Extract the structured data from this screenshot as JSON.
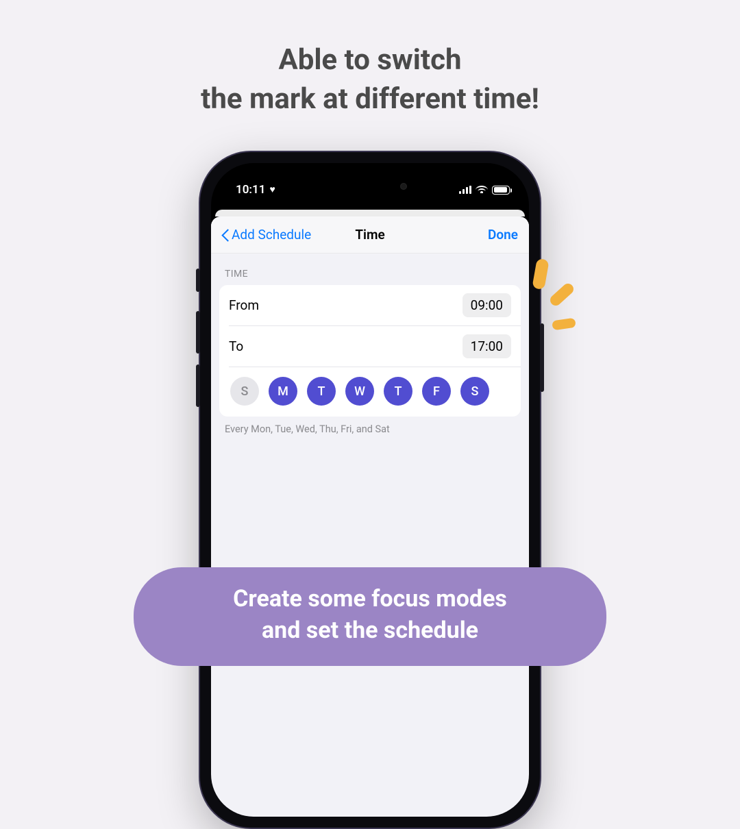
{
  "headline": {
    "line1": "Able to switch",
    "line2": "the mark at different time!"
  },
  "statusbar": {
    "time": "10:11"
  },
  "navbar": {
    "back_label": "Add Schedule",
    "title": "Time",
    "done_label": "Done"
  },
  "section": {
    "header": "TIME",
    "from_label": "From",
    "from_value": "09:00",
    "to_label": "To",
    "to_value": "17:00"
  },
  "days": [
    {
      "letter": "S",
      "selected": false
    },
    {
      "letter": "M",
      "selected": true
    },
    {
      "letter": "T",
      "selected": true
    },
    {
      "letter": "W",
      "selected": true
    },
    {
      "letter": "T",
      "selected": true
    },
    {
      "letter": "F",
      "selected": true
    },
    {
      "letter": "S",
      "selected": true
    }
  ],
  "footer_note": "Every Mon, Tue, Wed, Thu, Fri, and Sat",
  "pill": {
    "line1": "Create some focus modes",
    "line2": "and set the schedule"
  }
}
